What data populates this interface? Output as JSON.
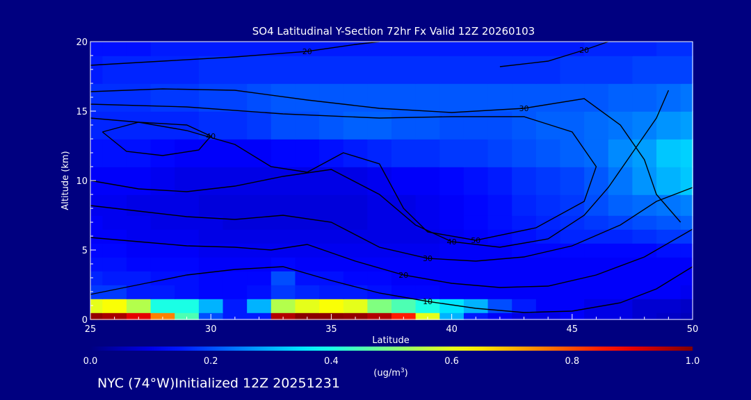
{
  "colors": {
    "background": "#000080",
    "text": "#ffffff",
    "contour": "#000000"
  },
  "footer": {
    "text": "NYC (74°W)Initialized 12Z 20251231"
  },
  "chart_data": {
    "type": "heatmap",
    "title": "SO4 Latitudinal Y-Section 72hr  Fx Valid 12Z 20260103",
    "xlabel": "Latitude",
    "ylabel": "Altitude (km)",
    "xlim": [
      25,
      50
    ],
    "ylim": [
      0,
      20
    ],
    "x_ticks": [
      25,
      30,
      35,
      40,
      45,
      50
    ],
    "y_ticks": [
      0,
      5,
      10,
      15,
      20
    ],
    "grid": false,
    "colorbar": {
      "min": 0.0,
      "max": 1.0,
      "ticks": [
        "0.0",
        "0.2",
        "0.4",
        "0.6",
        "0.8",
        "1.0"
      ],
      "label": "(ug/m",
      "label_sup": "3",
      "label_end": ")",
      "colormap": "jet"
    },
    "lat": [
      25,
      26,
      27,
      28,
      29,
      30,
      31,
      32,
      33,
      34,
      35,
      36,
      37,
      38,
      39,
      40,
      41,
      42,
      43,
      44,
      45,
      46,
      47,
      48,
      49,
      50
    ],
    "alt": [
      0,
      1,
      2,
      3,
      4,
      5,
      6,
      7,
      8,
      10,
      12,
      14,
      16,
      18,
      20
    ],
    "field": [
      [
        0.98,
        0.96,
        0.9,
        0.75,
        0.45,
        0.2,
        0.15,
        0.15,
        0.95,
        0.99,
        0.99,
        0.98,
        0.95,
        0.85,
        0.6,
        0.3,
        0.15,
        0.12,
        0.1,
        0.1,
        0.12,
        0.1,
        0.1,
        0.08,
        0.07,
        0.06
      ],
      [
        0.6,
        0.62,
        0.55,
        0.4,
        0.4,
        0.3,
        0.15,
        0.3,
        0.55,
        0.6,
        0.62,
        0.6,
        0.5,
        0.45,
        0.4,
        0.35,
        0.3,
        0.2,
        0.15,
        0.12,
        0.12,
        0.1,
        0.1,
        0.08,
        0.08,
        0.07
      ],
      [
        0.18,
        0.18,
        0.15,
        0.15,
        0.14,
        0.13,
        0.13,
        0.14,
        0.18,
        0.16,
        0.15,
        0.15,
        0.14,
        0.13,
        0.13,
        0.12,
        0.12,
        0.12,
        0.12,
        0.12,
        0.12,
        0.12,
        0.12,
        0.12,
        0.12,
        0.11
      ],
      [
        0.16,
        0.15,
        0.15,
        0.14,
        0.14,
        0.13,
        0.13,
        0.13,
        0.2,
        0.14,
        0.14,
        0.13,
        0.13,
        0.12,
        0.12,
        0.12,
        0.12,
        0.12,
        0.12,
        0.12,
        0.12,
        0.12,
        0.12,
        0.12,
        0.12,
        0.12
      ],
      [
        0.14,
        0.14,
        0.13,
        0.13,
        0.13,
        0.12,
        0.12,
        0.12,
        0.13,
        0.12,
        0.12,
        0.12,
        0.12,
        0.12,
        0.12,
        0.12,
        0.12,
        0.12,
        0.12,
        0.12,
        0.12,
        0.12,
        0.12,
        0.12,
        0.12,
        0.12
      ],
      [
        0.13,
        0.13,
        0.12,
        0.12,
        0.12,
        0.11,
        0.11,
        0.11,
        0.11,
        0.11,
        0.11,
        0.11,
        0.11,
        0.11,
        0.11,
        0.12,
        0.12,
        0.12,
        0.13,
        0.13,
        0.13,
        0.13,
        0.13,
        0.13,
        0.14,
        0.14
      ],
      [
        0.12,
        0.12,
        0.11,
        0.11,
        0.11,
        0.1,
        0.1,
        0.1,
        0.1,
        0.1,
        0.1,
        0.1,
        0.1,
        0.1,
        0.1,
        0.11,
        0.12,
        0.13,
        0.14,
        0.15,
        0.16,
        0.16,
        0.16,
        0.17,
        0.18,
        0.18
      ],
      [
        0.12,
        0.11,
        0.11,
        0.1,
        0.1,
        0.1,
        0.09,
        0.09,
        0.09,
        0.09,
        0.09,
        0.09,
        0.1,
        0.1,
        0.11,
        0.12,
        0.13,
        0.14,
        0.15,
        0.16,
        0.17,
        0.18,
        0.19,
        0.2,
        0.21,
        0.22
      ],
      [
        0.11,
        0.11,
        0.1,
        0.1,
        0.1,
        0.09,
        0.09,
        0.09,
        0.09,
        0.09,
        0.09,
        0.09,
        0.1,
        0.1,
        0.11,
        0.12,
        0.13,
        0.14,
        0.16,
        0.17,
        0.18,
        0.2,
        0.22,
        0.23,
        0.24,
        0.25
      ],
      [
        0.12,
        0.12,
        0.12,
        0.11,
        0.1,
        0.1,
        0.1,
        0.1,
        0.1,
        0.1,
        0.1,
        0.1,
        0.11,
        0.12,
        0.12,
        0.13,
        0.14,
        0.15,
        0.17,
        0.18,
        0.19,
        0.21,
        0.24,
        0.27,
        0.3,
        0.32
      ],
      [
        0.14,
        0.14,
        0.14,
        0.13,
        0.12,
        0.12,
        0.12,
        0.12,
        0.13,
        0.13,
        0.14,
        0.15,
        0.16,
        0.17,
        0.17,
        0.18,
        0.18,
        0.19,
        0.2,
        0.21,
        0.22,
        0.23,
        0.26,
        0.28,
        0.32,
        0.33
      ],
      [
        0.16,
        0.16,
        0.16,
        0.16,
        0.16,
        0.17,
        0.17,
        0.18,
        0.2,
        0.2,
        0.21,
        0.22,
        0.22,
        0.21,
        0.21,
        0.2,
        0.2,
        0.2,
        0.21,
        0.22,
        0.22,
        0.23,
        0.24,
        0.25,
        0.27,
        0.28
      ],
      [
        0.17,
        0.17,
        0.17,
        0.18,
        0.18,
        0.19,
        0.19,
        0.2,
        0.21,
        0.21,
        0.21,
        0.21,
        0.21,
        0.21,
        0.21,
        0.21,
        0.21,
        0.21,
        0.21,
        0.21,
        0.21,
        0.21,
        0.22,
        0.22,
        0.23,
        0.24
      ],
      [
        0.15,
        0.16,
        0.16,
        0.16,
        0.16,
        0.17,
        0.17,
        0.17,
        0.17,
        0.17,
        0.17,
        0.17,
        0.17,
        0.17,
        0.17,
        0.17,
        0.17,
        0.17,
        0.17,
        0.17,
        0.18,
        0.18,
        0.18,
        0.19,
        0.19,
        0.19
      ],
      [
        0.14,
        0.14,
        0.14,
        0.15,
        0.15,
        0.15,
        0.15,
        0.15,
        0.15,
        0.15,
        0.15,
        0.15,
        0.15,
        0.15,
        0.15,
        0.15,
        0.15,
        0.15,
        0.15,
        0.15,
        0.15,
        0.16,
        0.16,
        0.16,
        0.17,
        0.17
      ]
    ],
    "contours": [
      {
        "label": "10",
        "points": [
          [
            25,
            1.8
          ],
          [
            27,
            2.5
          ],
          [
            29,
            3.2
          ],
          [
            31,
            3.6
          ],
          [
            33,
            3.8
          ],
          [
            35,
            2.8
          ],
          [
            37,
            1.9
          ],
          [
            39,
            1.3
          ],
          [
            41,
            0.8
          ],
          [
            43,
            0.5
          ],
          [
            45,
            0.6
          ],
          [
            47,
            1.2
          ],
          [
            48.5,
            2.2
          ],
          [
            50,
            3.8
          ]
        ]
      },
      {
        "label": "20",
        "points": [
          [
            25,
            5.9
          ],
          [
            27,
            5.6
          ],
          [
            29,
            5.3
          ],
          [
            31,
            5.2
          ],
          [
            32.5,
            5.0
          ],
          [
            34,
            5.4
          ],
          [
            36,
            4.2
          ],
          [
            38,
            3.2
          ],
          [
            40,
            2.6
          ],
          [
            42,
            2.3
          ],
          [
            44,
            2.4
          ],
          [
            46,
            3.2
          ],
          [
            48,
            4.5
          ],
          [
            50,
            6.5
          ]
        ]
      },
      {
        "label": "30",
        "points": [
          [
            25,
            8.2
          ],
          [
            27,
            7.8
          ],
          [
            29,
            7.4
          ],
          [
            31,
            7.2
          ],
          [
            33,
            7.5
          ],
          [
            35,
            7.0
          ],
          [
            37,
            5.2
          ],
          [
            39,
            4.4
          ],
          [
            41,
            4.2
          ],
          [
            43,
            4.5
          ],
          [
            45,
            5.3
          ],
          [
            47,
            6.8
          ],
          [
            48.5,
            8.5
          ],
          [
            50,
            9.5
          ]
        ]
      },
      {
        "label": "40",
        "points": [
          [
            25,
            10.0
          ],
          [
            27,
            9.4
          ],
          [
            29,
            9.2
          ],
          [
            31,
            9.6
          ],
          [
            33,
            10.3
          ],
          [
            35,
            10.8
          ],
          [
            37,
            9.0
          ],
          [
            38.5,
            6.8
          ],
          [
            40,
            5.6
          ],
          [
            42,
            5.2
          ],
          [
            44,
            5.8
          ],
          [
            45.5,
            7.5
          ],
          [
            46.5,
            9.5
          ],
          [
            47.5,
            12.0
          ],
          [
            48.5,
            14.5
          ],
          [
            49,
            16.5
          ]
        ]
      },
      {
        "label": "50",
        "points": [
          [
            25,
            14.5
          ],
          [
            27,
            14.2
          ],
          [
            29,
            13.6
          ],
          [
            31,
            12.6
          ],
          [
            32.5,
            11.0
          ],
          [
            34,
            10.6
          ],
          [
            35.5,
            12.0
          ],
          [
            37,
            11.2
          ],
          [
            38,
            8.0
          ],
          [
            39,
            6.3
          ],
          [
            41,
            5.7
          ],
          [
            43.5,
            6.6
          ],
          [
            45.5,
            8.5
          ],
          [
            46,
            11.0
          ],
          [
            45,
            13.5
          ],
          [
            43,
            14.6
          ],
          [
            40,
            14.6
          ],
          [
            37,
            14.5
          ],
          [
            33,
            14.8
          ],
          [
            29,
            15.3
          ],
          [
            25,
            15.5
          ]
        ]
      },
      {
        "label": "40",
        "points": [
          [
            25.5,
            13.5
          ],
          [
            26.5,
            12.1
          ],
          [
            28,
            11.8
          ],
          [
            29.5,
            12.2
          ],
          [
            30,
            13.2
          ],
          [
            29,
            14.0
          ],
          [
            27,
            14.2
          ],
          [
            25.5,
            13.5
          ]
        ]
      },
      {
        "label": "30",
        "points": [
          [
            25,
            16.4
          ],
          [
            28,
            16.6
          ],
          [
            31,
            16.5
          ],
          [
            34,
            15.8
          ],
          [
            37,
            15.2
          ],
          [
            40,
            14.9
          ],
          [
            43,
            15.2
          ],
          [
            45.5,
            15.9
          ],
          [
            47,
            14.0
          ],
          [
            48,
            11.5
          ],
          [
            48.5,
            9.0
          ],
          [
            49.5,
            7.0
          ]
        ]
      },
      {
        "label": "20",
        "points": [
          [
            25,
            18.3
          ],
          [
            28,
            18.6
          ],
          [
            31,
            18.9
          ],
          [
            34,
            19.3
          ],
          [
            36,
            19.8
          ],
          [
            37,
            20
          ]
        ]
      },
      {
        "label": "20",
        "points": [
          [
            42,
            18.2
          ],
          [
            44,
            18.6
          ],
          [
            45.5,
            19.4
          ],
          [
            46.5,
            20
          ]
        ]
      }
    ]
  }
}
